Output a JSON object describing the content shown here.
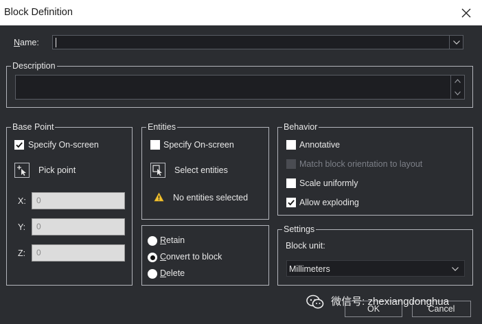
{
  "window": {
    "title": "Block Definition"
  },
  "name": {
    "label": "Name:",
    "value": ""
  },
  "description": {
    "legend": "Description",
    "value": ""
  },
  "base_point": {
    "legend": "Base Point",
    "specify_label": "Specify On-screen",
    "specify_checked": true,
    "pick_label": "Pick point",
    "x_label": "X:",
    "x_value": "0",
    "y_label": "Y:",
    "y_value": "0",
    "z_label": "Z:",
    "z_value": "0"
  },
  "entities": {
    "legend": "Entities",
    "specify_label": "Specify On-screen",
    "specify_checked": false,
    "select_label": "Select entities",
    "warning_text": "No entities selected"
  },
  "retain_group": {
    "retain_label": "Retain",
    "convert_label": "Convert to block",
    "delete_label": "Delete",
    "selected": "Convert to block"
  },
  "behavior": {
    "legend": "Behavior",
    "annotative_label": "Annotative",
    "annotative_checked": false,
    "match_label": "Match block orientation to layout",
    "match_enabled": false,
    "scale_label": "Scale uniformly",
    "scale_checked": false,
    "explode_label": "Allow exploding",
    "explode_checked": true
  },
  "settings": {
    "legend": "Settings",
    "unit_label": "Block unit:",
    "unit_value": "Millimeters"
  },
  "buttons": {
    "ok": "OK",
    "cancel": "Cancel"
  },
  "watermark": {
    "text": "微信号: zhexiangdonghua"
  },
  "colors": {
    "background": "#2b2d31",
    "field": "#1d1e22",
    "border": "#b4b6bc",
    "titlebar": "#ffffff"
  }
}
